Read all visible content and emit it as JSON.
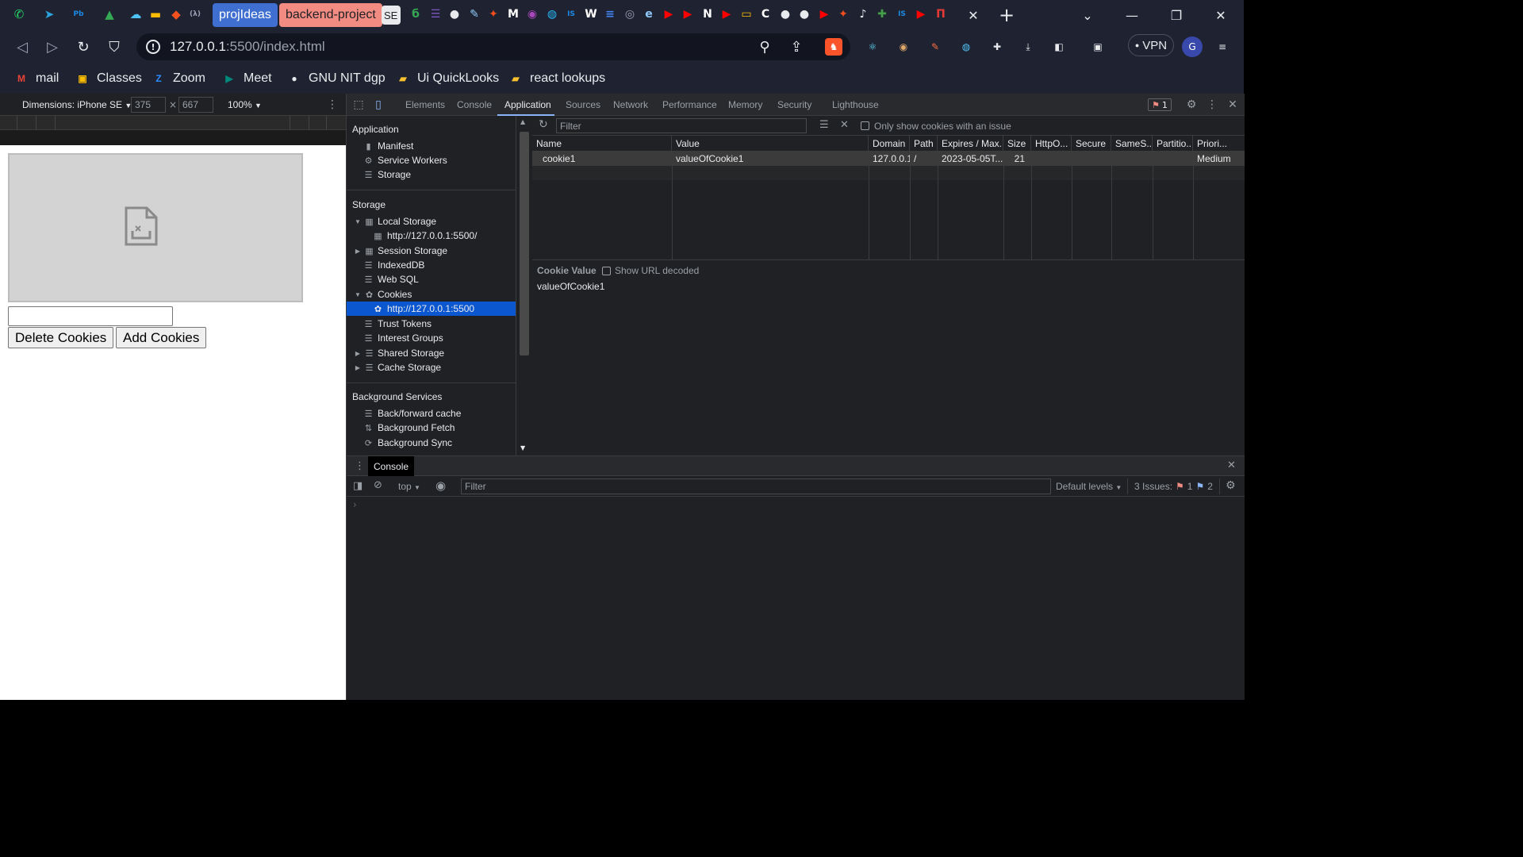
{
  "browser": {
    "tabs": {
      "pinned_icons": [
        {
          "name": "whatsapp-icon",
          "glyph": "✆",
          "color": "#25d366"
        },
        {
          "name": "telegram-icon",
          "glyph": "➤",
          "color": "#2aa3df"
        },
        {
          "name": "pwskills-icon",
          "glyph": "Pb",
          "color": "#1e88e5"
        },
        {
          "name": "google-drive-icon",
          "glyph": "▲",
          "color": "#34a853"
        },
        {
          "name": "cloud-icon",
          "glyph": "☁",
          "color": "#4fc3f7"
        },
        {
          "name": "keep-icon",
          "glyph": "▬",
          "color": "#fbbc04"
        },
        {
          "name": "diamond-icon",
          "glyph": "◆",
          "color": "#f4511e"
        },
        {
          "name": "lambda-icon",
          "glyph": "(λ)",
          "color": "#9aa0b4"
        }
      ],
      "projideas_label": "projIdeas",
      "backend_project_label": "backend-project",
      "se_label": "SE",
      "trailing_icons": [
        {
          "name": "leetcode-icon",
          "glyph": "б",
          "color": "#34a853"
        },
        {
          "name": "forms-icon",
          "glyph": "☰",
          "color": "#7e57c2"
        },
        {
          "name": "github-icon",
          "glyph": "●",
          "color": "#e8eaed"
        },
        {
          "name": "tools-icon",
          "glyph": "✎",
          "color": "#90caf9"
        },
        {
          "name": "figma-icon",
          "glyph": "✦",
          "color": "#f24e1e"
        },
        {
          "name": "medium-icon",
          "glyph": "M",
          "color": "#ffffff"
        },
        {
          "name": "podcast-icon",
          "glyph": "◉",
          "color": "#ab47bc"
        },
        {
          "name": "globe-blue-icon",
          "glyph": "◍",
          "color": "#29b6f6"
        },
        {
          "name": "is-icon",
          "glyph": "IS",
          "color": "#1e88e5"
        },
        {
          "name": "w-icon",
          "glyph": "W",
          "color": "#ffffff"
        },
        {
          "name": "docs-icon",
          "glyph": "≡",
          "color": "#4285f4"
        },
        {
          "name": "globe-icon",
          "glyph": "◎",
          "color": "#9aa0b4"
        },
        {
          "name": "edge-icon",
          "glyph": "e",
          "color": "#90caf9"
        },
        {
          "name": "youtube-icon-1",
          "glyph": "▶",
          "color": "#ff0000"
        },
        {
          "name": "youtube-icon-2",
          "glyph": "▶",
          "color": "#ff0000"
        },
        {
          "name": "notion-icon",
          "glyph": "N",
          "color": "#ffffff"
        },
        {
          "name": "youtube-icon-3",
          "glyph": "▶",
          "color": "#ff0000"
        },
        {
          "name": "slides-icon",
          "glyph": "▭",
          "color": "#fbbc04"
        },
        {
          "name": "codechef-icon",
          "glyph": "C",
          "color": "#ffffff"
        },
        {
          "name": "github-icon-2",
          "glyph": "●",
          "color": "#e8eaed"
        },
        {
          "name": "github-icon-3",
          "glyph": "●",
          "color": "#e8eaed"
        },
        {
          "name": "youtube-icon-4",
          "glyph": "▶",
          "color": "#ff0000"
        },
        {
          "name": "figma-icon-2",
          "glyph": "✦",
          "color": "#f24e1e"
        },
        {
          "name": "notification-icon",
          "glyph": "♪",
          "color": "#e8eaed"
        },
        {
          "name": "plus-green-icon",
          "glyph": "✚",
          "color": "#43a047"
        },
        {
          "name": "is-icon-2",
          "glyph": "IS",
          "color": "#1e88e5"
        },
        {
          "name": "youtube-icon-5",
          "glyph": "▶",
          "color": "#ff0000"
        },
        {
          "name": "red-tab-icon",
          "glyph": "П",
          "color": "#e53935"
        }
      ]
    },
    "url": {
      "host": "127.0.0.1",
      "rest": ":5500/index.html"
    },
    "vpn_label": "VPN",
    "bookmarks": [
      {
        "name": "bookmark-mail",
        "label": "mail",
        "glyph": "M",
        "color": "#ea4335"
      },
      {
        "name": "bookmark-classes",
        "label": "Classes",
        "glyph": "▣",
        "color": "#fbbc04"
      },
      {
        "name": "bookmark-zoom",
        "label": "Zoom",
        "glyph": "Z",
        "color": "#2d8cff"
      },
      {
        "name": "bookmark-meet",
        "label": "Meet",
        "glyph": "▶",
        "color": "#00897b"
      },
      {
        "name": "bookmark-gnu-nit-dgp",
        "label": "GNU NIT dgp",
        "glyph": "●",
        "color": "#e8eaed"
      },
      {
        "name": "bookmark-ui-quicklooks",
        "label": "Ui QuickLooks",
        "glyph": "▰",
        "color": "#fbc02d"
      },
      {
        "name": "bookmark-react-lookups",
        "label": "react lookups",
        "glyph": "▰",
        "color": "#fbc02d"
      }
    ]
  },
  "device_toolbar": {
    "dimensions_label": "Dimensions: iPhone SE",
    "width": "375",
    "times": "×",
    "height": "667",
    "zoom": "100%"
  },
  "page": {
    "input_value": "",
    "delete_label": "Delete Cookies",
    "add_label": "Add Cookies"
  },
  "devtools": {
    "tabs": [
      "Elements",
      "Console",
      "Application",
      "Sources",
      "Network",
      "Performance",
      "Memory",
      "Security",
      "Lighthouse"
    ],
    "active_tab": "Application",
    "issues_badge": "1",
    "sidebar": {
      "application_heading": "Application",
      "application_items": [
        "Manifest",
        "Service Workers",
        "Storage"
      ],
      "storage_heading": "Storage",
      "local_storage": "Local Storage",
      "local_storage_origin": "http://127.0.0.1:5500/",
      "session_storage": "Session Storage",
      "indexeddb": "IndexedDB",
      "web_sql": "Web SQL",
      "cookies": "Cookies",
      "cookies_origin": "http://127.0.0.1:5500",
      "trust_tokens": "Trust Tokens",
      "interest_groups": "Interest Groups",
      "shared_storage": "Shared Storage",
      "cache_storage": "Cache Storage",
      "background_heading": "Background Services",
      "background_items": [
        "Back/forward cache",
        "Background Fetch",
        "Background Sync"
      ]
    },
    "cookies": {
      "filter_placeholder": "Filter",
      "only_issues_label": "Only show cookies with an issue",
      "columns": [
        "Name",
        "Value",
        "Domain",
        "Path",
        "Expires / Max...",
        "Size",
        "HttpO...",
        "Secure",
        "SameS...",
        "Partitio...",
        "Priori..."
      ],
      "rows": [
        {
          "name": "cookie1",
          "value": "valueOfCookie1",
          "domain": "127.0.0.1",
          "path": "/",
          "expires": "2023-05-05T...",
          "size": "21",
          "httponly": "",
          "secure": "",
          "samesite": "",
          "partition": "",
          "priority": "Medium"
        }
      ],
      "cookie_value_label": "Cookie Value",
      "show_url_decoded_label": "Show URL decoded",
      "cookie_value": "valueOfCookie1"
    },
    "drawer": {
      "tab_label": "Console",
      "context": "top",
      "filter_placeholder": "Filter",
      "levels": "Default levels",
      "issues_label": "3 Issues:",
      "issues_errors": "1",
      "issues_info": "2",
      "prompt": "›"
    }
  }
}
